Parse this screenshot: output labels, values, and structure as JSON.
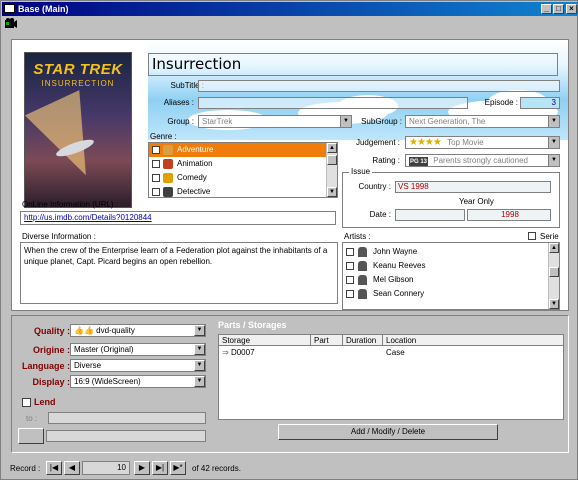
{
  "window": {
    "title": "Base (Main)"
  },
  "movie": {
    "title": "Insurrection",
    "poster": {
      "line1": "STAR TREK",
      "line2": "INSURRECTION"
    },
    "subtitle": "",
    "aliases": "",
    "episode_label": "Episode :",
    "episode": "3",
    "group_label": "Group :",
    "group": "StarTrek",
    "subgroup_label": "SubGroup :",
    "subgroup": "Next Generation, The",
    "judgement_label": "Judgement :",
    "judgement": "Top Movie",
    "judgement_stars": "★★★★",
    "rating_label": "Rating :",
    "rating": "Parents strongly cautioned",
    "rating_badge": "PG 13"
  },
  "labels": {
    "subtitle": "SubTitle :",
    "aliases": "Aliases :",
    "genre": "Genre :",
    "issue": "Issue",
    "country": "Country :",
    "year_only": "Year Only",
    "date": "Date :",
    "online": "OnLine Information (URL) :",
    "diverse": "Diverse Information :",
    "artists": "Artists :",
    "serie": "Serie"
  },
  "genres": [
    {
      "label": "Adventure",
      "selected": true,
      "color": "#d8a040"
    },
    {
      "label": "Animation",
      "selected": false,
      "color": "#c04020"
    },
    {
      "label": "Comedy",
      "selected": false,
      "color": "#e0a000"
    },
    {
      "label": "Detective",
      "selected": false,
      "color": "#404040"
    }
  ],
  "issue": {
    "country": "VS 1998",
    "year": "1998",
    "date": ""
  },
  "url": "http://us.imdb.com/Details?0120844",
  "diverse_info": "When the crew of the Enterprise learn of a Federation plot against the inhabitants of a unique planet, Capt. Picard begins an open rebellion.",
  "artists": [
    "John Wayne",
    "Keanu Reeves",
    "Mel Gibson",
    "Sean Connery"
  ],
  "quality": {
    "label": "Quality :",
    "value": "dvd-quality"
  },
  "origine": {
    "label": "Origine :",
    "value": "Master (Original)"
  },
  "language": {
    "label": "Language :",
    "value": "Diverse"
  },
  "display": {
    "label": "Display :",
    "value": "16:9 (WideScreen)"
  },
  "lend": {
    "label": "Lend",
    "to_label": "to :"
  },
  "parts": {
    "title": "Parts / Storages",
    "columns": [
      "Storage",
      "Part",
      "Duration",
      "Location"
    ],
    "rows": [
      {
        "storage": "D0007",
        "part": "",
        "duration": "",
        "location": "Case"
      }
    ],
    "button": "Add / Modify / Delete"
  },
  "record": {
    "label": "Record :",
    "current": "10",
    "total_text": "of 42 records."
  },
  "colors": {
    "title_bar": "#000080",
    "selection": "#f07c0a",
    "accent_red": "#800000"
  }
}
